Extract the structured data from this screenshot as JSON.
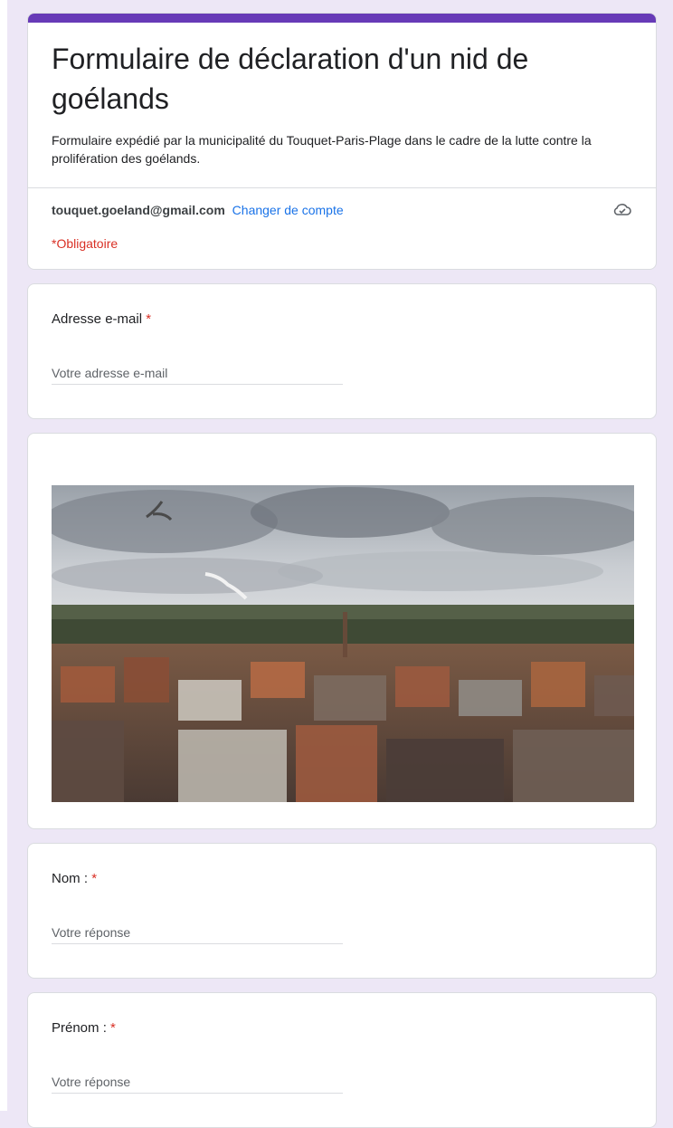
{
  "form": {
    "title": "Formulaire de déclaration d'un nid de goélands",
    "description": "Formulaire expédié par la municipalité du Touquet-Paris-Plage dans le cadre de la lutte contre la prolifération des goélands.",
    "account_email": "touquet.goeland@gmail.com",
    "switch_account": "Changer de compte",
    "required_note": "*Obligatoire",
    "accent_color": "#673ab7"
  },
  "questions": [
    {
      "label": "Adresse e-mail",
      "required_mark": "*",
      "placeholder": "Votre adresse e-mail"
    },
    {
      "label": "Nom :",
      "required_mark": "*",
      "placeholder": "Votre réponse"
    },
    {
      "label": "Prénom :",
      "required_mark": "*",
      "placeholder": "Votre réponse"
    }
  ],
  "icons": {
    "cloud": "cloud-check-icon"
  },
  "image": {
    "description_icon": "photo"
  }
}
